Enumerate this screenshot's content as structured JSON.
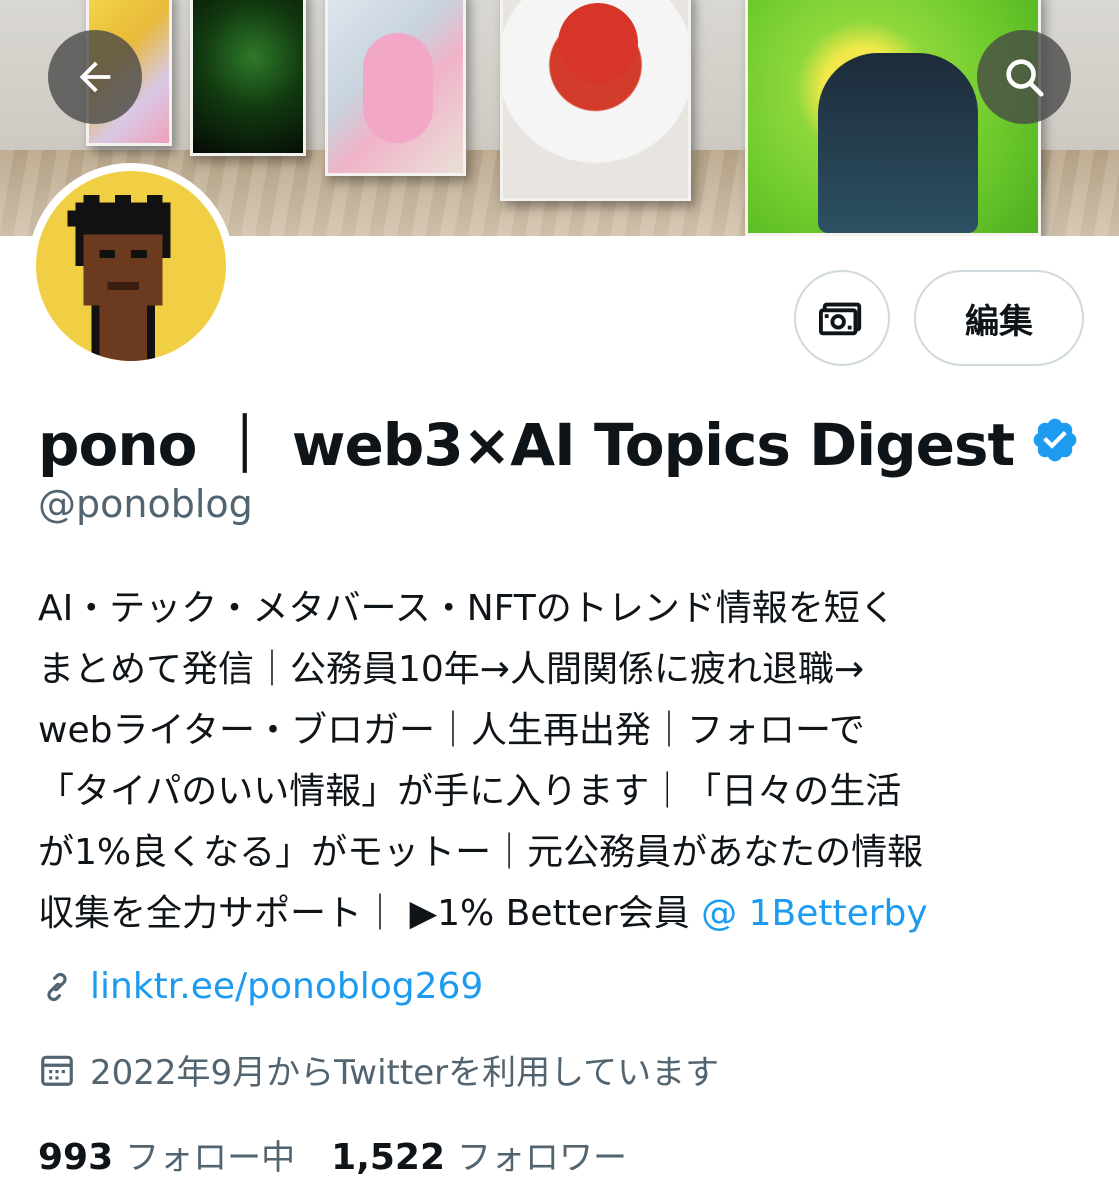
{
  "header": {
    "back_icon": "arrow-left-icon",
    "search_icon": "search-icon"
  },
  "profile": {
    "display_name": "pono ｜ web3×AI Topics Digest",
    "handle": "@ponoblog",
    "verified": true,
    "verified_color": "#1d9bf0"
  },
  "actions": {
    "tip_icon": "money-icon",
    "edit_label": "編集"
  },
  "bio": {
    "lines": [
      "AI・テック・メタバース・NFTのトレンド情報を短く",
      "まとめて発信｜公務員10年→人間関係に疲れ退職→",
      "webライター・ブロガー｜人生再出発｜フォローで",
      "「タイパのいい情報」が手に入ります｜「日々の生活",
      "が1%良くなる」がモットー｜元公務員があなたの情報"
    ],
    "last_line_text": "収集を全力サポート｜ ▶1% Better会員 ",
    "mention": "@ 1Betterby"
  },
  "link": {
    "icon": "link-icon",
    "text": "linktr.ee/ponoblog269"
  },
  "joined": {
    "icon": "calendar-icon",
    "text": "2022年9月からTwitterを利用しています"
  },
  "stats": {
    "following_count": "993",
    "following_label": "フォロー中",
    "followers_count": "1,522",
    "followers_label": "フォロワー"
  }
}
